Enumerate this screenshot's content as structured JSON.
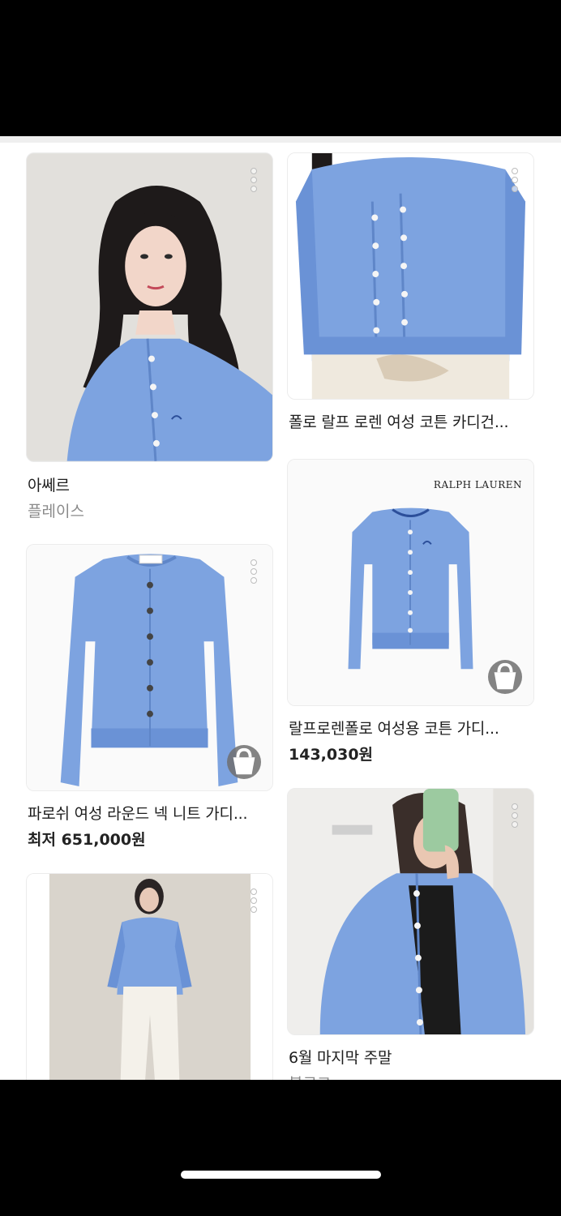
{
  "cards": [
    {
      "title": "아쎄르",
      "subtitle": "플레이스",
      "price": ""
    },
    {
      "title": "폴로 랄프 로렌 여성 코튼 카디건...",
      "subtitle": "",
      "price": ""
    },
    {
      "title": "랄프로렌폴로 여성용 코튼 가디...",
      "subtitle": "",
      "price": "143,030원",
      "logo": "Ralph Lauren"
    },
    {
      "title": "파로쉬 여성 라운드 넥 니트 가디...",
      "subtitle": "",
      "price": "최저 651,000원"
    },
    {
      "title": "",
      "subtitle": "",
      "price": ""
    },
    {
      "title": "6월 마지막 주말",
      "subtitle": "블로그",
      "price": ""
    }
  ],
  "colors": {
    "cardigan_blue": "#7da3e0",
    "cardigan_shadow": "#5f86c8",
    "hair": "#1e1a1a",
    "wall": "#e5e3df"
  },
  "icons": [
    "more-icon",
    "shopping-bag-icon"
  ]
}
